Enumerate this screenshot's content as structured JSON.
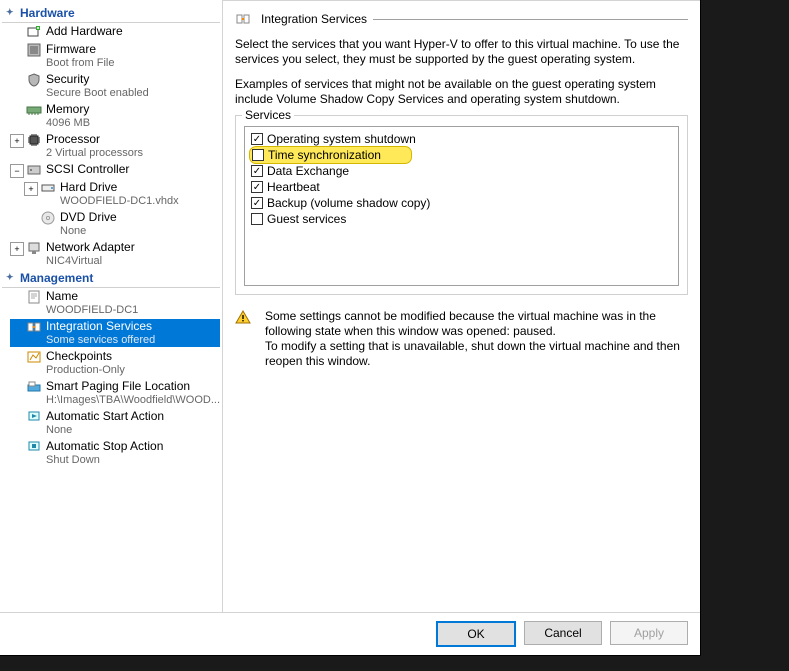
{
  "left": {
    "sections": {
      "hardware": "Hardware",
      "management": "Management"
    },
    "items": {
      "addHardware": {
        "label": "Add Hardware"
      },
      "firmware": {
        "label": "Firmware",
        "sub": "Boot from File"
      },
      "security": {
        "label": "Security",
        "sub": "Secure Boot enabled"
      },
      "memory": {
        "label": "Memory",
        "sub": "4096 MB"
      },
      "processor": {
        "label": "Processor",
        "sub": "2 Virtual processors"
      },
      "scsi": {
        "label": "SCSI Controller"
      },
      "hardDrive": {
        "label": "Hard Drive",
        "sub": "WOODFIELD-DC1.vhdx"
      },
      "dvd": {
        "label": "DVD Drive",
        "sub": "None"
      },
      "nic": {
        "label": "Network Adapter",
        "sub": "NIC4Virtual"
      },
      "name": {
        "label": "Name",
        "sub": "WOODFIELD-DC1"
      },
      "integration": {
        "label": "Integration Services",
        "sub": "Some services offered"
      },
      "checkpoints": {
        "label": "Checkpoints",
        "sub": "Production-Only"
      },
      "smartPaging": {
        "label": "Smart Paging File Location",
        "sub": "H:\\Images\\TBA\\Woodfield\\WOOD..."
      },
      "autoStart": {
        "label": "Automatic Start Action",
        "sub": "None"
      },
      "autoStop": {
        "label": "Automatic Stop Action",
        "sub": "Shut Down"
      }
    }
  },
  "right": {
    "title": "Integration Services",
    "desc1": "Select the services that you want Hyper-V to offer to this virtual machine. To use the services you select, they must be supported by the guest operating system.",
    "desc2": "Examples of services that might not be available on the guest operating system include Volume Shadow Copy Services and operating system shutdown.",
    "servicesLegend": "Services",
    "services": [
      {
        "label": "Operating system shutdown",
        "checked": true,
        "highlight": false
      },
      {
        "label": "Time synchronization",
        "checked": false,
        "highlight": true
      },
      {
        "label": "Data Exchange",
        "checked": true,
        "highlight": false
      },
      {
        "label": "Heartbeat",
        "checked": true,
        "highlight": false
      },
      {
        "label": "Backup (volume shadow copy)",
        "checked": true,
        "highlight": false
      },
      {
        "label": "Guest services",
        "checked": false,
        "highlight": false
      }
    ],
    "warning1": "Some settings cannot be modified because the virtual machine was in the following state when this window was opened: paused.",
    "warning2": "To modify a setting that is unavailable, shut down the virtual machine and then reopen this window."
  },
  "buttons": {
    "ok": "OK",
    "cancel": "Cancel",
    "apply": "Apply"
  }
}
